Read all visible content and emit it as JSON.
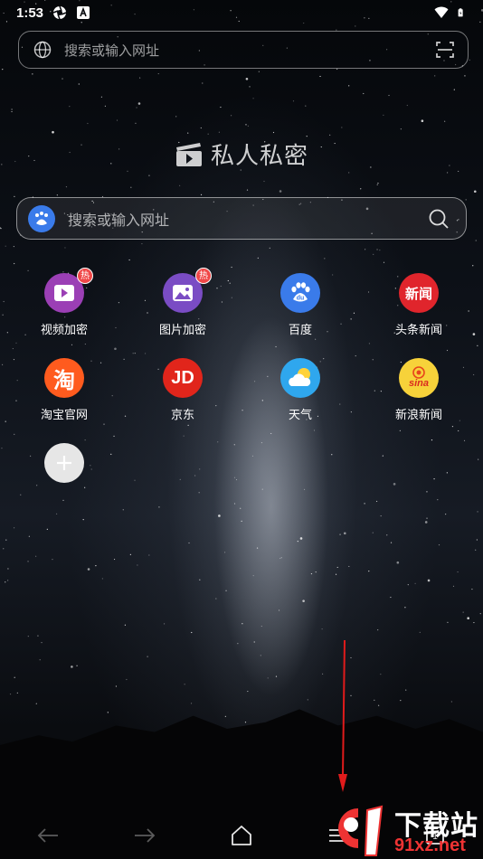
{
  "status_bar": {
    "time": "1:53"
  },
  "top_bar": {
    "placeholder": "搜索或输入网址"
  },
  "brand": {
    "title": "私人私密"
  },
  "search": {
    "placeholder": "搜索或输入网址"
  },
  "shortcuts": [
    {
      "label": "视频加密",
      "badge": "热",
      "color": "#9b3fb5",
      "icon": "play-icon"
    },
    {
      "label": "图片加密",
      "badge": "热",
      "color": "#7a4cc4",
      "icon": "image-icon"
    },
    {
      "label": "百度",
      "color": "#3a7bea",
      "icon": "baidu-paw-icon"
    },
    {
      "label": "头条新闻",
      "color": "#e0252c",
      "icon": "toutiao-icon",
      "icon_text": "新闻"
    },
    {
      "label": "淘宝官网",
      "color": "#ff5b1e",
      "icon": "taobao-icon",
      "icon_text": "淘"
    },
    {
      "label": "京东",
      "color": "#e1251b",
      "icon": "jd-icon",
      "icon_text": "JD"
    },
    {
      "label": "天气",
      "color": "#2fa7ee",
      "icon": "weather-icon"
    },
    {
      "label": "新浪新闻",
      "color": "#f7d23a",
      "icon": "sina-icon",
      "icon_text": "sina"
    },
    {
      "label": "",
      "color": "#e6e6e6",
      "icon": "add-icon"
    }
  ],
  "watermark": {
    "top": "下载站",
    "bottom": "91xz.net"
  }
}
